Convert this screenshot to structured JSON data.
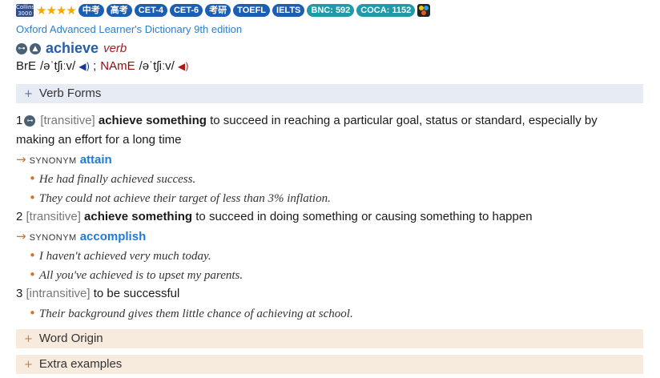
{
  "tags": {
    "book_top": "Collins",
    "book_bottom": "3000",
    "stars": "★★★★",
    "levels": [
      "中考",
      "高考",
      "CET-4",
      "CET-6",
      "考研",
      "TOEFL",
      "IELTS"
    ],
    "bnc": "BNC: 592",
    "coca": "COCA: 1152"
  },
  "source": "Oxford Advanced Learner's Dictionary 9th edition",
  "entry": {
    "headword": "achieve",
    "pos": "verb",
    "bre_label": "BrE",
    "bre_ipa": "/əˈtʃiːv/",
    "separator": ";",
    "name_label": "NAmE",
    "name_ipa": "/əˈtʃiːv/"
  },
  "sections": {
    "verb_forms": "Verb Forms",
    "word_origin": "Word Origin",
    "extra_examples": "Extra examples"
  },
  "senses": [
    {
      "num": "1",
      "grammar": "[transitive]",
      "pattern": "achieve something",
      "def_line1": "to succeed in reaching a particular goal, status or standard, especially by",
      "def_line2": "making an effort for a long time",
      "synonym_label": "SYNONYM",
      "synonym": "attain",
      "examples": [
        "He had finally achieved success.",
        "They could not achieve their target of less than 3% inflation."
      ]
    },
    {
      "num": "2",
      "grammar": "[transitive]",
      "pattern": "achieve something",
      "def_line1": "to succeed in doing something or causing something to happen",
      "synonym_label": "SYNONYM",
      "synonym": "accomplish",
      "examples": [
        "I haven't achieved very much today.",
        "All you've achieved is to upset my parents."
      ]
    },
    {
      "num": "3",
      "grammar": "[intransitive]",
      "def_line1": "to be successful",
      "examples": [
        "Their background gives them little chance of achieving at school."
      ]
    }
  ],
  "colors": {
    "accent_blue": "#2a5da8",
    "link_blue": "#2a7fc9",
    "tag_blue": "#1a5fb4",
    "tag_teal": "#1e9aa8",
    "bullet_orange": "#d1752b",
    "pos_red": "#a02020"
  },
  "icons": {
    "level_icon": "book-icon",
    "chart_icon": "pie-chart-icon",
    "key_icon": "key-icon",
    "academic_icon": "graduation-cap-icon",
    "uk_audio_icon": "speaker-icon",
    "us_audio_icon": "speaker-icon"
  }
}
